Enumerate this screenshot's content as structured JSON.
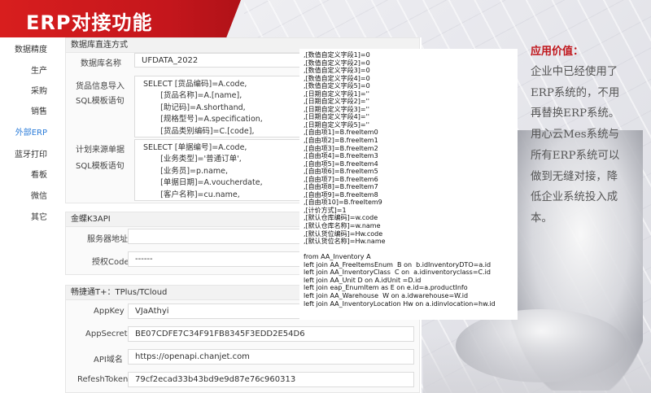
{
  "banner": {
    "title": "ERP对接功能"
  },
  "sidebar": {
    "items": [
      {
        "label": "数据精度"
      },
      {
        "label": "生产"
      },
      {
        "label": "采购"
      },
      {
        "label": "销售"
      },
      {
        "label": "外部ERP"
      },
      {
        "label": "蓝牙打印"
      },
      {
        "label": "看板"
      },
      {
        "label": "微信"
      },
      {
        "label": "其它"
      }
    ]
  },
  "db_section": {
    "header": "数据库直连方式",
    "db_name_label": "数据库名称",
    "db_name_value": "UFDATA_2022",
    "goods_label_1": "货品信息导入",
    "goods_label_2": "SQL模板语句",
    "goods_sql": "SELECT [货品编码]=A.code,\n       [货品名称]=A.[name],\n       [助记码]=A.shorthand,\n       [规格型号]=A.specification,\n       [货品类别编码]=C.[code],",
    "plan_label_1": "计划来源单据",
    "plan_label_2": "SQL模板语句",
    "plan_sql": "SELECT [单据编号]=A.code,\n       [业务类型]='普通订单',\n       [业务员]=p.name,\n       [单据日期]=A.voucherdate,\n       [客户名称]=cu.name,"
  },
  "k3_section": {
    "header": "金蝶K3API",
    "server_label": "服务器地址",
    "server_value": "",
    "auth_label": "授权Code",
    "auth_value": "------"
  },
  "tplus_section": {
    "header": "畅捷通T+：TPlus/TCloud",
    "appkey_label": "AppKey",
    "appkey_value": "VJaAthyi",
    "appsecret_label": "AppSecret",
    "appsecret_value": "BE07CDFE7C34F91FB8345F3EDD2E54D6",
    "apidomain_label": "API域名",
    "apidomain_value": "https://openapi.chanjet.com",
    "refresh_label": "RefeshToken",
    "refresh_value": "79cf2ecad33b43bd9e9d87e76c960313"
  },
  "sql_overlay": {
    "text": ",[数值自定义字段1]=0\n,[数值自定义字段2]=0\n,[数值自定义字段3]=0\n,[数值自定义字段4]=0\n,[数值自定义字段5]=0\n,[日期自定义字段1]=''\n,[日期自定义字段2]=''\n,[日期自定义字段3]=''\n,[日期自定义字段4]=''\n,[日期自定义字段5]=''\n,[自由项1]=B.freeItem0\n,[自由项2]=B.freeItem1\n,[自由项3]=B.freeItem2\n,[自由项4]=B.freeItem3\n,[自由项5]=B.freeItem4\n,[自由项6]=B.freeItem5\n,[自由项7]=B.freeItem6\n,[自由项8]=B.freeItem7\n,[自由项9]=B.freeItem8\n,[自由项10]=B.freeItem9\n,[计价方式]=1\n,[默认仓库编码]=w.code\n,[默认仓库名称]=w.name\n,[默认货位编码]=Hw.code\n,[默认货位名称]=Hw.name\n\nfrom AA_Inventory A\nleft join AA_FreeItemsEnum  B on  b.idInventoryDTO=a.id\nleft join AA_InventoryClass  C on  a.idinventoryclass=C.id\nleft join AA_Unit D on A.idUnit =D.id\nleft join eap_EnumItem as E on e.id=a.productInfo\nleft join AA_Warehouse  W on a.idwarehouse=W.id\nleft join AA_InventoryLocation Hw on a.idinvlocation=hw.id"
  },
  "value_prop": {
    "title": "应用价值：",
    "text": "企业中已经使用了\nERP系统的，不用\n再替换ERP系统。\n用心云Mes系统与\n所有ERP系统可以\n做到无缝对接，降\n低企业系统投入成\n本。"
  },
  "colors": {
    "brand_red": "#c4161c",
    "active_blue": "#2b7cd9"
  }
}
